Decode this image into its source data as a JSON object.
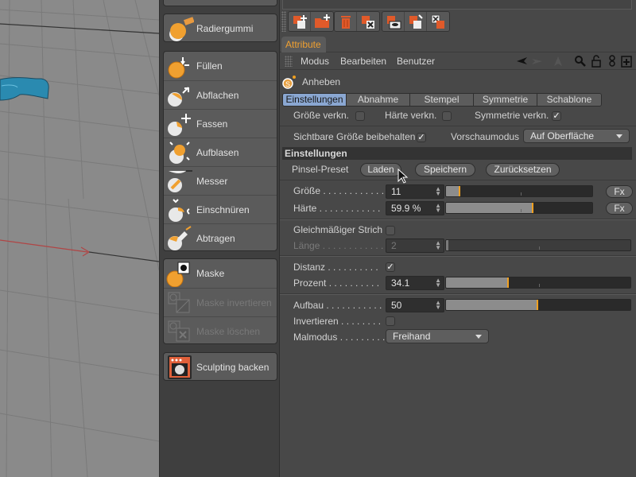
{
  "tools": {
    "group1": [
      {
        "label": "Radiergummi",
        "icon": "eraser-icon",
        "enabled": true
      }
    ],
    "group2": [
      {
        "label": "Füllen",
        "icon": "fill-icon",
        "enabled": true
      },
      {
        "label": "Abflachen",
        "icon": "flatten-icon",
        "enabled": true
      },
      {
        "label": "Fassen",
        "icon": "grab-icon",
        "enabled": true
      },
      {
        "label": "Aufblasen",
        "icon": "inflate-icon",
        "enabled": true
      },
      {
        "label": "Messer",
        "icon": "knife-icon",
        "enabled": true
      },
      {
        "label": "Einschnüren",
        "icon": "pinch-icon",
        "enabled": true
      },
      {
        "label": "Abtragen",
        "icon": "scrape-icon",
        "enabled": true
      }
    ],
    "group3": [
      {
        "label": "Maske",
        "icon": "mask-icon",
        "enabled": true
      },
      {
        "label": "Maske invertieren",
        "icon": "mask-invert-icon",
        "enabled": false
      },
      {
        "label": "Maske löschen",
        "icon": "mask-clear-icon",
        "enabled": false
      }
    ],
    "group4": [
      {
        "label": "Sculpting backen",
        "icon": "bake-icon",
        "enabled": true
      }
    ]
  },
  "attributes": {
    "tab_label": "Attribute",
    "menu": {
      "modus": "Modus",
      "bearbeiten": "Bearbeiten",
      "benutzer": "Benutzer"
    },
    "object_name": "Anheben",
    "subtabs": [
      "Einstellungen",
      "Abnahme",
      "Stempel",
      "Symmetrie",
      "Schablone"
    ],
    "active_subtab": "Einstellungen",
    "links": {
      "size_link": {
        "label": "Größe verkn.",
        "checked": false
      },
      "hardness_link": {
        "label": "Härte verkn.",
        "checked": false
      },
      "symmetry_link": {
        "label": "Symmetrie verkn.",
        "checked": true
      }
    },
    "keep_visible_size": {
      "label": "Sichtbare Größe beibehalten",
      "checked": true
    },
    "preview_mode": {
      "label": "Vorschaumodus",
      "value": "Auf Oberfläche"
    },
    "section_title": "Einstellungen",
    "brush_preset": {
      "label": "Pinsel-Preset",
      "load": "Laden",
      "save": "Speichern",
      "reset": "Zurücksetzen"
    },
    "size": {
      "label": "Größe . . . . . . . . . . . .",
      "value": "11",
      "slider_fraction": 0.1,
      "fx": "Fx"
    },
    "hardness": {
      "label": "Härte . . . . . . . . . . . .",
      "value": "59.9 %",
      "slider_fraction": 0.599,
      "fx": "Fx"
    },
    "even_stroke": {
      "label": "Gleichmäßiger Strich",
      "checked": false
    },
    "length": {
      "label": "Länge . . . . . . . . . . . .",
      "value": "2",
      "slider_fraction": 0.01
    },
    "distance": {
      "label": "Distanz . . . . . . . . . .",
      "checked": true
    },
    "percent": {
      "label": "Prozent . . . . . . . . . .",
      "value": "34.1",
      "slider_fraction": 0.341
    },
    "buildup": {
      "label": "Aufbau . . . . . . . . . . .",
      "value": "50",
      "slider_fraction": 0.5
    },
    "invert": {
      "label": "Invertieren . . . . . . . .",
      "checked": false
    },
    "paint_mode": {
      "label": "Malmodus . . . . . . . . .",
      "value": "Freihand"
    }
  },
  "toolbar_icons": [
    "new-tag-icon",
    "new-folder-icon",
    "delete-icon",
    "remove-tag-icon",
    "view-tag-icon",
    "copy-tag-icon",
    "swap-tag-icon"
  ],
  "colors": {
    "accent": "#f0a020",
    "active_tab": "#8aa7d2",
    "tab_label": "#f0a030",
    "mesh": "#2a8ab0"
  }
}
